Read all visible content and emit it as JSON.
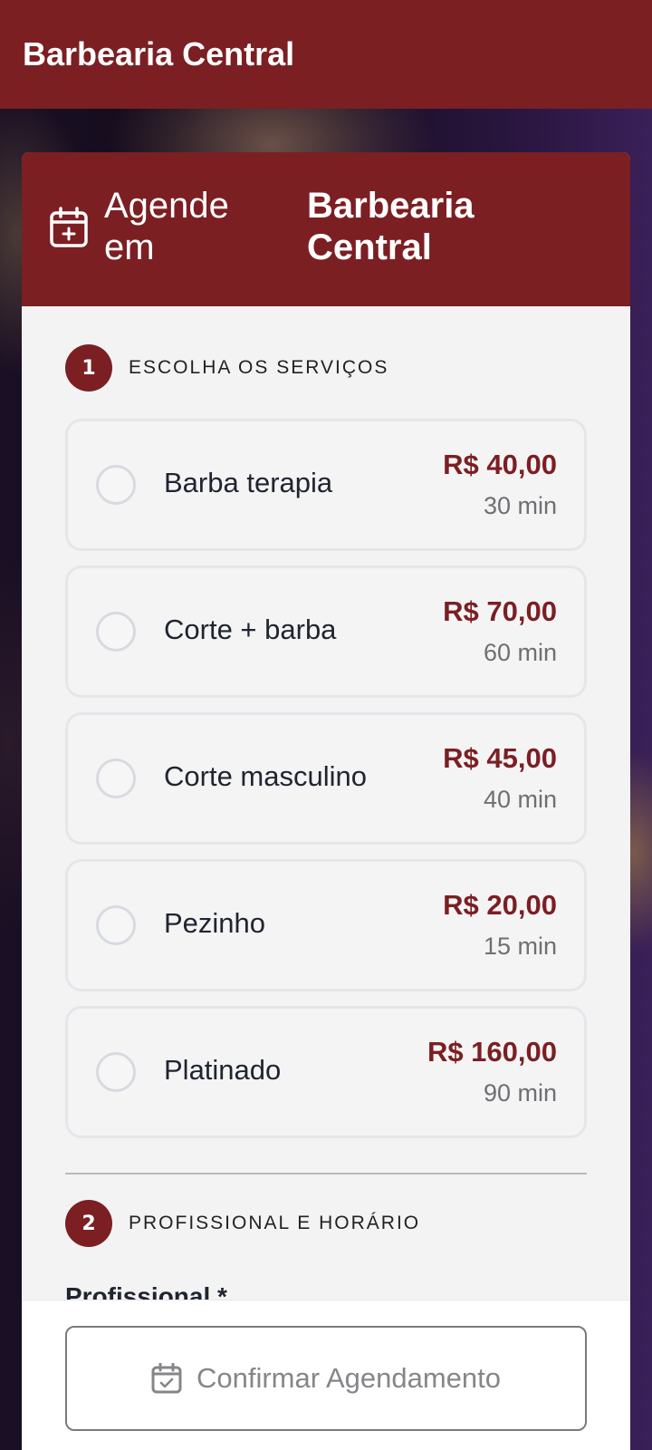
{
  "app": {
    "title": "Barbearia Central"
  },
  "booking_header": {
    "prefix": "Agende em",
    "shop": "Barbearia Central",
    "icon": "calendar-plus-icon"
  },
  "sections": [
    {
      "number": "1",
      "title": "ESCOLHA OS SERVIÇOS"
    },
    {
      "number": "2",
      "title": "PROFISSIONAL E HORÁRIO"
    }
  ],
  "services": [
    {
      "name": "Barba terapia",
      "price": "R$ 40,00",
      "duration": "30 min"
    },
    {
      "name": "Corte + barba",
      "price": "R$ 70,00",
      "duration": "60 min"
    },
    {
      "name": "Corte masculino",
      "price": "R$ 45,00",
      "duration": "40 min"
    },
    {
      "name": "Pezinho",
      "price": "R$ 20,00",
      "duration": "15 min"
    },
    {
      "name": "Platinado",
      "price": "R$ 160,00",
      "duration": "90 min"
    }
  ],
  "professional_field": {
    "label": "Profissional *"
  },
  "footer": {
    "confirm_label": "Confirmar Agendamento",
    "icon": "calendar-check-icon"
  },
  "colors": {
    "brand": "#7b1f23",
    "card_bg": "#f3f3f4",
    "border": "#e4e6ea"
  }
}
